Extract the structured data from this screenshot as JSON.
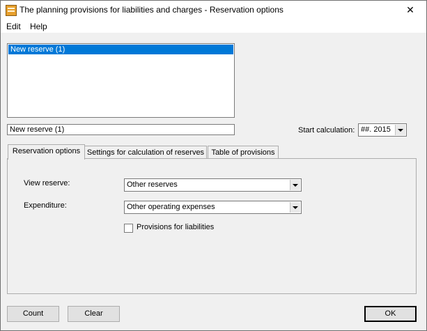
{
  "window": {
    "title": "The planning provisions for liabilities and charges - Reservation options"
  },
  "menu": [
    {
      "label": "Edit"
    },
    {
      "label": "Help"
    }
  ],
  "reserves_list": {
    "items": [
      "New reserve (1)"
    ],
    "selected_index": 0
  },
  "reserve_name": {
    "value": "New reserve (1)"
  },
  "start_calculation": {
    "label": "Start calculation:",
    "value": "##. 2015"
  },
  "tabs": [
    {
      "label": "Reservation options",
      "active": true
    },
    {
      "label": "Settings for calculation of reserves",
      "active": false
    },
    {
      "label": "Table of provisions",
      "active": false
    }
  ],
  "options": {
    "view_reserve": {
      "label": "View reserve:",
      "value": "Other reserves"
    },
    "expenditure": {
      "label": "Expenditure:",
      "value": "Other operating expenses"
    },
    "provisions_checkbox": {
      "label": "Provisions for liabilities",
      "checked": false
    }
  },
  "buttons": {
    "count": "Count",
    "clear": "Clear",
    "ok": "OK"
  },
  "icons": {
    "app": "calculator-icon",
    "close": "close-icon"
  }
}
